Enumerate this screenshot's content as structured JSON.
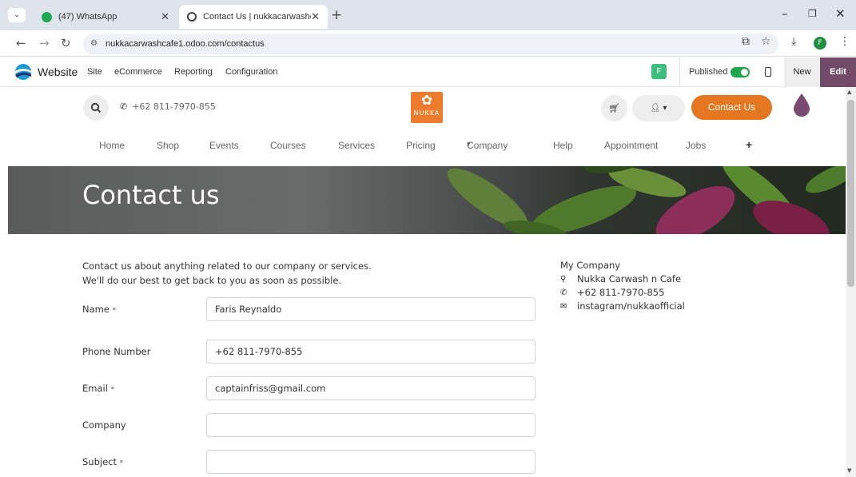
{
  "browser": {
    "tabs": [
      {
        "title": "(47) WhatsApp",
        "active": false
      },
      {
        "title": "Contact Us | nukkacarwashcafe",
        "active": true
      }
    ],
    "url": "nukkacarwashcafe1.odoo.com/contactus",
    "profile_initial": "F"
  },
  "odoo_bar": {
    "brand": "Website",
    "menu": [
      "Site",
      "eCommerce",
      "Reporting",
      "Configuration"
    ],
    "user_badge": "F",
    "published_label": "Published",
    "published": true,
    "new_label": "New",
    "edit_label": "Edit"
  },
  "site_header": {
    "phone": "+62 811-7970-855",
    "logo_text": "NUKKA",
    "contact_button": "Contact Us",
    "nav": [
      "Home",
      "Shop",
      "Events",
      "Courses",
      "Services",
      "Pricing",
      "Company",
      "Help",
      "Appointment",
      "Jobs"
    ]
  },
  "banner": {
    "title": "Contact us"
  },
  "form": {
    "intro_line1": "Contact us about anything related to our company or services.",
    "intro_line2": "We'll do our best to get back to you as soon as possible.",
    "fields": [
      {
        "label": "Name",
        "required": "*",
        "value": "Faris Reynaldo"
      },
      {
        "label": "Phone Number",
        "required": "",
        "value": "+62 811-7970-855"
      },
      {
        "label": "Email",
        "required": "*",
        "value": "captainfriss@gmail.com"
      },
      {
        "label": "Company",
        "required": "",
        "value": ""
      },
      {
        "label": "Subject",
        "required": "*",
        "value": ""
      }
    ]
  },
  "company": {
    "name": "My Company",
    "address": "Nukka Carwash n Cafe",
    "phone": "+62 811-7970-855",
    "email": "instagram/nukkaofficial"
  },
  "colors": {
    "accent": "#e4771f",
    "odoo_purple": "#714b67",
    "toggle_green": "#1ea64a"
  }
}
